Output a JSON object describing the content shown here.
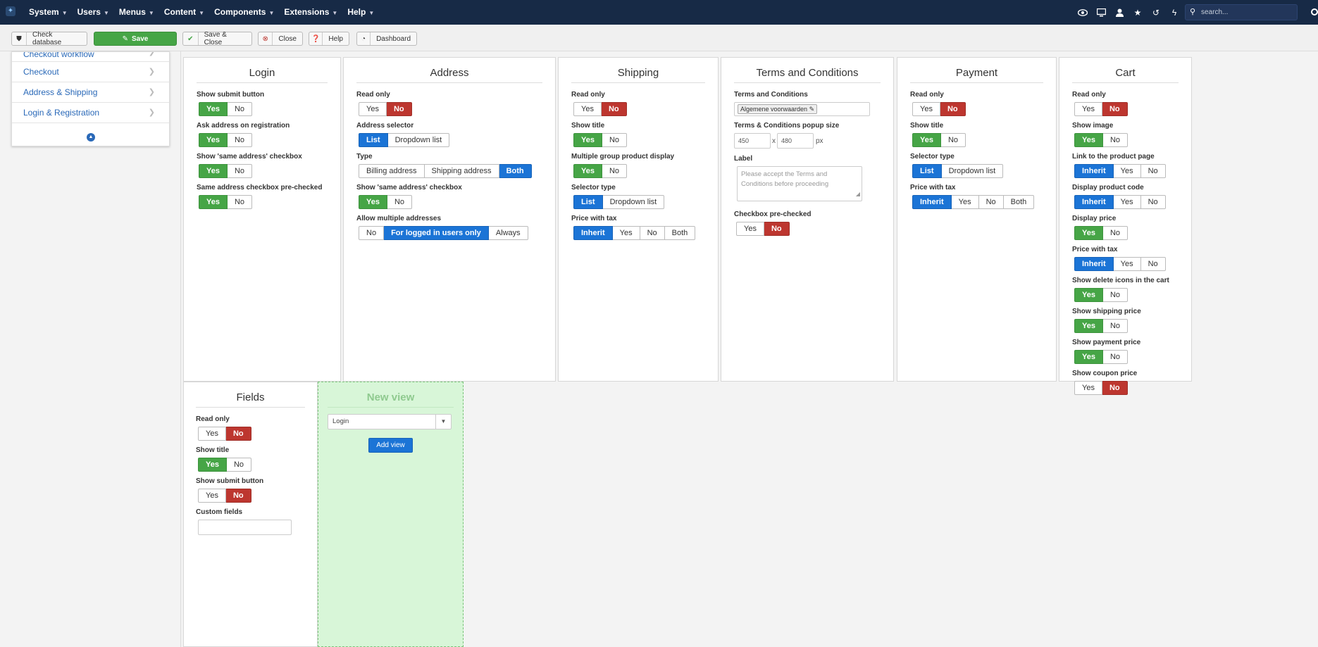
{
  "topnav": {
    "brand_icon": "joomla-icon",
    "menu": [
      "System",
      "Users",
      "Menus",
      "Content",
      "Components",
      "Extensions",
      "Help"
    ],
    "search_placeholder": "search..."
  },
  "toolbar": {
    "check_db": "Check database",
    "save": "Save",
    "save_close": "Save & Close",
    "close": "Close",
    "help": "Help",
    "dashboard": "Dashboard"
  },
  "sidebar": {
    "items": [
      "Checkout workflow",
      "Checkout",
      "Address & Shipping",
      "Login & Registration"
    ]
  },
  "login": {
    "title": "Login",
    "f1": "Show submit button",
    "f2": "Ask address on registration",
    "f3": "Show 'same address' checkbox",
    "f4": "Same address checkbox pre-checked"
  },
  "address": {
    "title": "Address",
    "f1": "Read only",
    "f2": "Address selector",
    "f3": "Type",
    "f4": "Show 'same address' checkbox",
    "f5": "Allow multiple addresses",
    "list": "List",
    "dropdown": "Dropdown list",
    "billing": "Billing address",
    "shipping": "Shipping address",
    "both": "Both",
    "no": "No",
    "logged": "For logged in users only",
    "always": "Always"
  },
  "shipping": {
    "title": "Shipping",
    "f1": "Read only",
    "f2": "Show title",
    "f3": "Multiple group product display",
    "f4": "Selector type",
    "f5": "Price with tax",
    "list": "List",
    "dropdown": "Dropdown list",
    "inherit": "Inherit",
    "both": "Both"
  },
  "terms": {
    "title": "Terms and Conditions",
    "f1": "Terms and Conditions",
    "tag": "Algemene voorwaarden",
    "f2": "Terms & Conditions popup size",
    "w": "450",
    "x": "x",
    "h": "480",
    "px": "px",
    "f3": "Label",
    "placeholder": "Please accept the Terms and Conditions before proceeding",
    "f4": "Checkbox pre-checked"
  },
  "payment": {
    "title": "Payment",
    "f1": "Read only",
    "f2": "Show title",
    "f3": "Selector type",
    "f4": "Price with tax",
    "list": "List",
    "dropdown": "Dropdown list",
    "inherit": "Inherit",
    "both": "Both"
  },
  "cart": {
    "title": "Cart",
    "f1": "Read only",
    "f2": "Show image",
    "f3": "Link to the product page",
    "f4": "Display product code",
    "f5": "Display price",
    "f6": "Price with tax",
    "f7": "Show delete icons in the cart",
    "f8": "Show shipping price",
    "f9": "Show payment price",
    "f10": "Show coupon price",
    "inherit": "Inherit"
  },
  "fields": {
    "title": "Fields",
    "f1": "Read only",
    "f2": "Show title",
    "f3": "Show submit button",
    "f4": "Custom fields"
  },
  "newview": {
    "title": "New view",
    "select": "Login",
    "add": "Add view"
  },
  "common": {
    "yes": "Yes",
    "no": "No"
  },
  "colors": {
    "navbar": "#172a46",
    "green": "#46a546",
    "red": "#bd362f",
    "blue": "#1b74d6"
  }
}
